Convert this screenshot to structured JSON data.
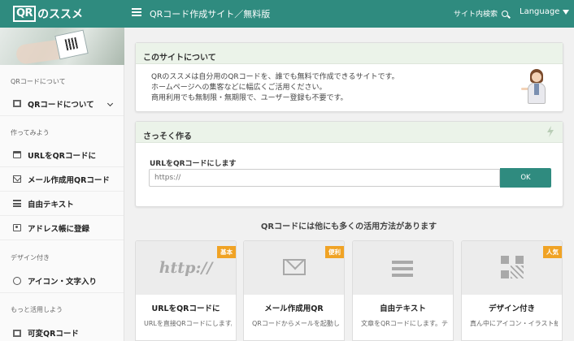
{
  "header": {
    "brand_qr": "QR",
    "brand_text": "のススメ",
    "site_title": "QRコード作成サイト／無料版",
    "search_label": "サイト内検索",
    "language_label": "Language"
  },
  "sidebar": {
    "sections": [
      "QRコードについて",
      "作ってみよう",
      "デザイン付き",
      "もっと活用しよう"
    ],
    "items": [
      {
        "label": "QRコードについて",
        "icon": "qr-icon"
      },
      {
        "label": "URLをQRコードに",
        "icon": "window-icon"
      },
      {
        "label": "メール作成用QRコード",
        "icon": "mail-icon"
      },
      {
        "label": "自由テキスト",
        "icon": "text-lines-icon"
      },
      {
        "label": "アドレス帳に登録",
        "icon": "address-book-icon"
      },
      {
        "label": "アイコン・文字入り",
        "icon": "smile-icon"
      },
      {
        "label": "可変QRコード",
        "icon": "qr-icon"
      }
    ]
  },
  "about": {
    "title": "このサイトについて",
    "lines": [
      "QRのススメは自分用のQRコードを、誰でも無料で作成できるサイトです。",
      "ホームページへの集客などに幅広くご活用ください。",
      "商用利用でも無制限・無期限で、ユーザー登録も不要です。"
    ]
  },
  "quick": {
    "title": "さっそく作る",
    "url_label": "URLをQRコードにします",
    "url_placeholder": "https://",
    "ok_label": "OK"
  },
  "features_heading": "QRコードには他にも多くの活用方法があります",
  "features": [
    {
      "title": "URLをQRコードに",
      "badge": "基本",
      "glyph": "http://",
      "desc": "URLを直接QRコードにします。一番シンプルな使"
    },
    {
      "title": "メール作成用QR",
      "badge": "便利",
      "desc": "QRコードからメールを起動します。件名・本文の"
    },
    {
      "title": "自由テキスト",
      "badge": "",
      "desc": "文章をQRコードにします。テキストは自由に指"
    },
    {
      "title": "デザイン付き",
      "badge": "人気",
      "desc": "真ん中にアイコン・イラスト絵や、文字を重ねら"
    }
  ],
  "colors": {
    "accent": "#2f8b7f",
    "badge": "#f0a325",
    "card_head": "#ebf3e9"
  }
}
